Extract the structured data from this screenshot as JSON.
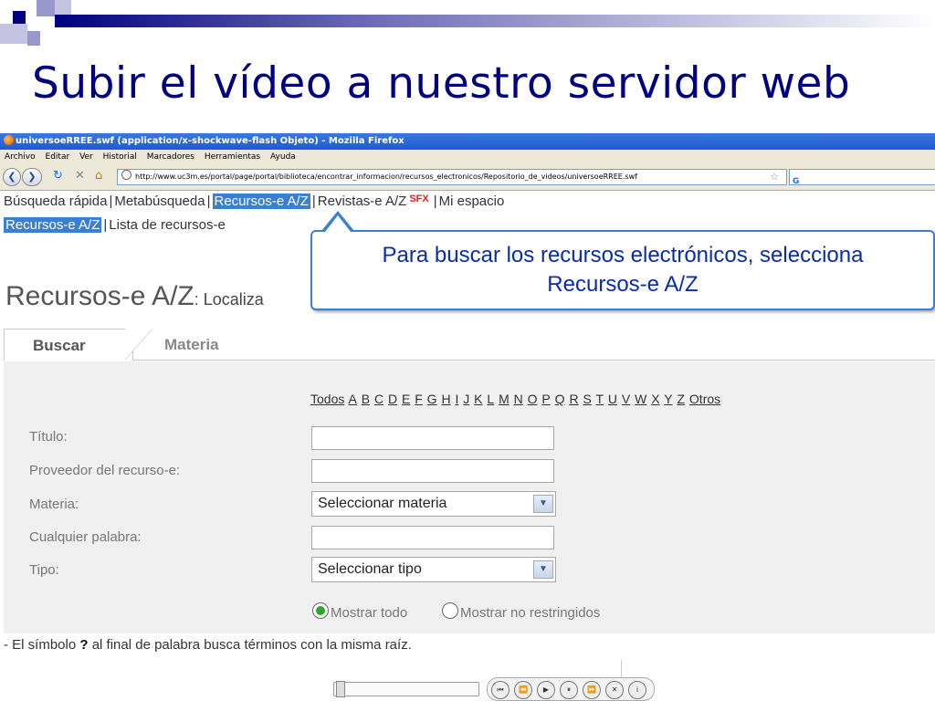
{
  "slide": {
    "title": "Subir el vídeo a nuestro servidor web"
  },
  "browser": {
    "window_title": "universoeRREE.swf (application/x-shockwave-flash Objeto) - Mozilla Firefox",
    "menu": [
      "Archivo",
      "Editar",
      "Ver",
      "Historial",
      "Marcadores",
      "Herramientas",
      "Ayuda"
    ],
    "url": "http://www.uc3m.es/portal/page/portal/biblioteca/encontrar_informacion/recursos_electronicos/Repositorio_de_videos/universoeRREE.swf",
    "search_engine_icon": "G",
    "nav_icons": {
      "back": "back-arrow-icon",
      "forward": "forward-arrow-icon",
      "reload": "reload-icon",
      "stop": "stop-icon",
      "home": "home-icon"
    }
  },
  "page": {
    "top_tabs": {
      "tab1": "Búsqueda rápida",
      "tab2": "Metabúsqueda",
      "tab3": "Recursos-e A/Z",
      "tab4": "Revistas-e A/Z",
      "sfx": "SFX",
      "tab5": "Mi espacio"
    },
    "sub_tabs": {
      "tab1": "Recursos-e A/Z",
      "tab2": "Lista de recursos-e"
    },
    "callout": {
      "line1": "Para buscar los recursos electrónicos, selecciona",
      "line2": "Recursos-e A/Z"
    },
    "heading": {
      "title": "Recursos-e A/Z",
      "subtitle": ": Localiza"
    },
    "form_tabs": {
      "active": "Buscar",
      "other": "Materia"
    },
    "alphabet": [
      "Todos",
      "A",
      "B",
      "C",
      "D",
      "E",
      "F",
      "G",
      "H",
      "I",
      "J",
      "K",
      "L",
      "M",
      "N",
      "O",
      "P",
      "Q",
      "R",
      "S",
      "T",
      "U",
      "V",
      "W",
      "X",
      "Y",
      "Z",
      "Otros"
    ],
    "fields": {
      "titulo": "Título:",
      "proveedor": "Proveedor del recurso-e:",
      "materia": "Materia:",
      "palabra": "Cualquier palabra:",
      "tipo": "Tipo:"
    },
    "selects": {
      "materia": "Seleccionar materia",
      "tipo": "Seleccionar tipo"
    },
    "radios": {
      "opt1": "Mostrar todo",
      "opt2": "Mostrar no restringidos",
      "selected": "Mostrar todo"
    },
    "note": {
      "prefix": "- El símbolo ",
      "symbol": "?",
      "suffix": " al final de palabra busca términos con la misma raíz."
    }
  },
  "player": {
    "buttons": [
      "first-icon",
      "rewind-icon",
      "play-icon",
      "pause-icon",
      "forward-icon",
      "stop-icon",
      "info-icon"
    ]
  }
}
